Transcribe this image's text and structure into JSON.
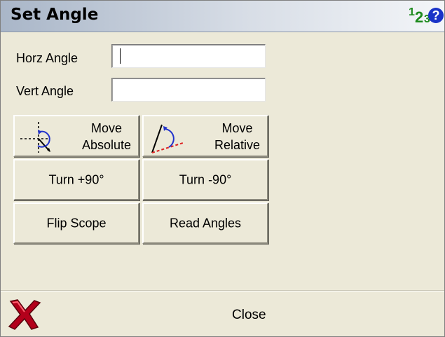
{
  "window": {
    "title": "Set Angle",
    "num_icon": {
      "a": "1",
      "b": "2",
      "c": "3"
    },
    "help_symbol": "?"
  },
  "form": {
    "horz_label": "Horz Angle",
    "horz_value": "",
    "vert_label": "Vert Angle",
    "vert_value": ""
  },
  "buttons": {
    "move_absolute": {
      "line1": "Move",
      "line2": "Absolute"
    },
    "move_relative": {
      "line1": "Move",
      "line2": "Relative"
    },
    "turn_plus": "Turn +90°",
    "turn_minus": "Turn -90°",
    "flip_scope": "Flip Scope",
    "read_angles": "Read Angles"
  },
  "footer": {
    "close_label": "Close"
  },
  "colors": {
    "background": "#ece9d8",
    "help_icon": "#1a33c8",
    "num_icon": "#1d8a1d",
    "close_x": "#b3001b"
  },
  "icons": {
    "help": "help-circle-icon",
    "num": "numeric-123-icon",
    "move_absolute": "move-absolute-icon",
    "move_relative": "move-relative-icon",
    "close": "red-x-close-icon"
  }
}
